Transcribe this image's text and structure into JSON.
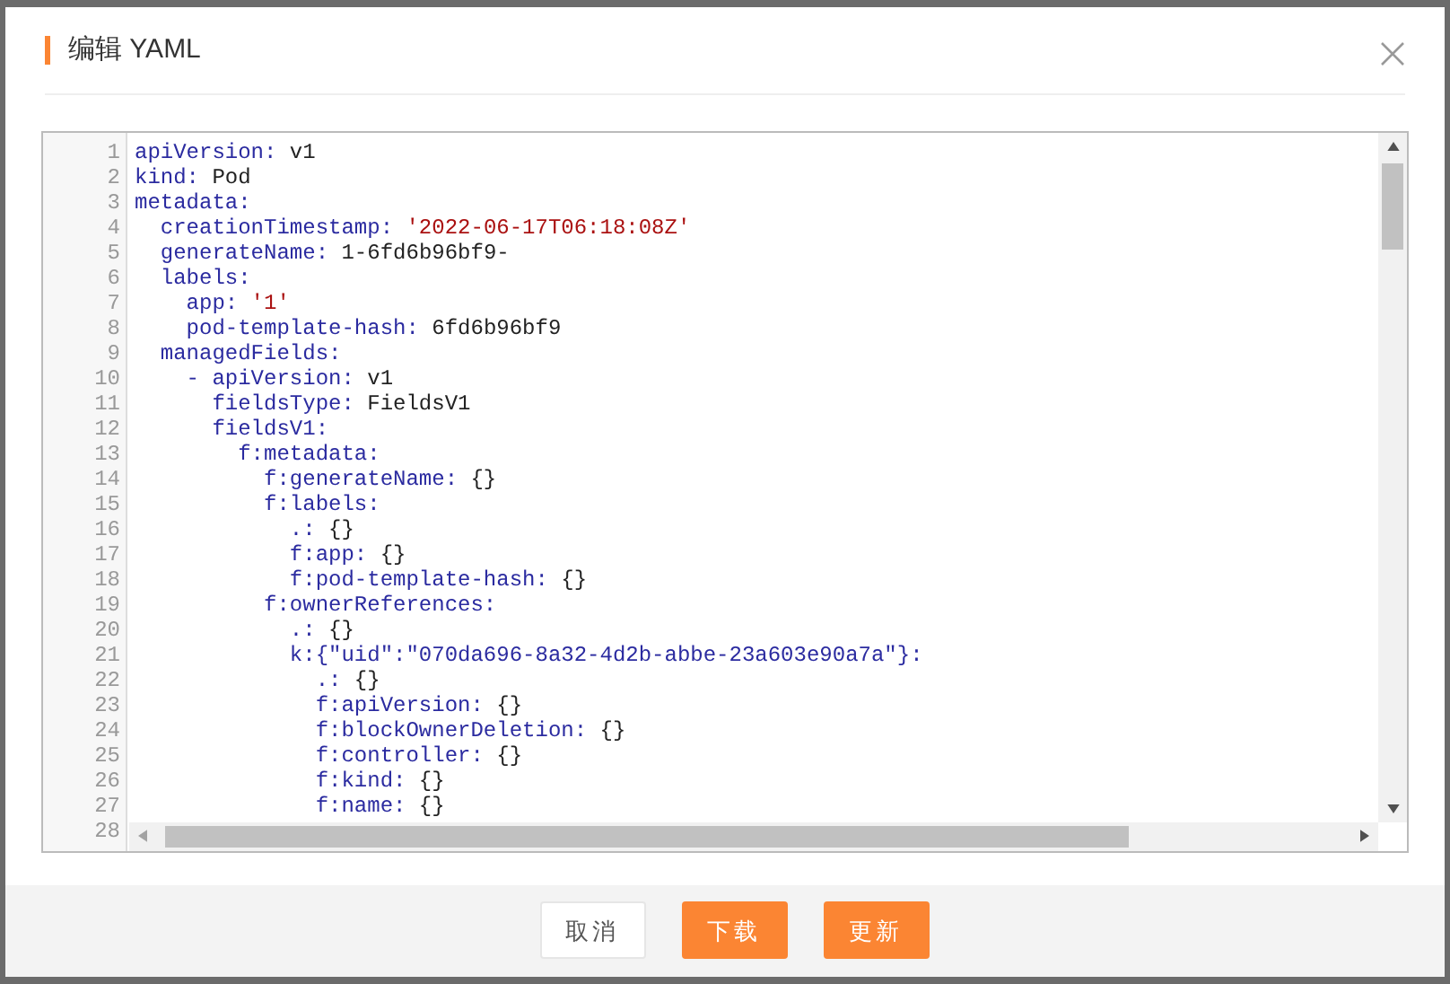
{
  "dialog": {
    "title": "编辑 YAML"
  },
  "editor": {
    "lines": [
      {
        "number": "1",
        "key": "apiVersion:",
        "value": " v1",
        "kind": "plain"
      },
      {
        "number": "2",
        "key": "kind:",
        "value": " Pod",
        "kind": "plain"
      },
      {
        "number": "3",
        "key": "metadata:"
      },
      {
        "number": "4",
        "key": "  creationTimestamp:",
        "value": " '2022-06-17T06:18:08Z'",
        "kind": "string"
      },
      {
        "number": "5",
        "key": "  generateName:",
        "value": " 1-6fd6b96bf9-",
        "kind": "plain"
      },
      {
        "number": "6",
        "key": "  labels:"
      },
      {
        "number": "7",
        "key": "    app:",
        "value": " '1'",
        "kind": "string"
      },
      {
        "number": "8",
        "key": "    pod-template-hash:",
        "value": " 6fd6b96bf9",
        "kind": "plain"
      },
      {
        "number": "9",
        "key": "  managedFields:"
      },
      {
        "number": "10",
        "key": "    - apiVersion:",
        "value": " v1",
        "kind": "plain"
      },
      {
        "number": "11",
        "key": "      fieldsType:",
        "value": " FieldsV1",
        "kind": "plain"
      },
      {
        "number": "12",
        "key": "      fieldsV1:"
      },
      {
        "number": "13",
        "key": "        f:metadata:"
      },
      {
        "number": "14",
        "key": "          f:generateName:",
        "value": " {}",
        "kind": "plain"
      },
      {
        "number": "15",
        "key": "          f:labels:"
      },
      {
        "number": "16",
        "key": "            .:",
        "value": " {}",
        "kind": "plain"
      },
      {
        "number": "17",
        "key": "            f:app:",
        "value": " {}",
        "kind": "plain"
      },
      {
        "number": "18",
        "key": "            f:pod-template-hash:",
        "value": " {}",
        "kind": "plain"
      },
      {
        "number": "19",
        "key": "          f:ownerReferences:"
      },
      {
        "number": "20",
        "key": "            .:",
        "value": " {}",
        "kind": "plain"
      },
      {
        "number": "21",
        "key": "            k:{\"uid\":\"070da696-8a32-4d2b-abbe-23a603e90a7a\"}:"
      },
      {
        "number": "22",
        "key": "              .:",
        "value": " {}",
        "kind": "plain"
      },
      {
        "number": "23",
        "key": "              f:apiVersion:",
        "value": " {}",
        "kind": "plain"
      },
      {
        "number": "24",
        "key": "              f:blockOwnerDeletion:",
        "value": " {}",
        "kind": "plain"
      },
      {
        "number": "25",
        "key": "              f:controller:",
        "value": " {}",
        "kind": "plain"
      },
      {
        "number": "26",
        "key": "              f:kind:",
        "value": " {}",
        "kind": "plain"
      },
      {
        "number": "27",
        "key": "              f:name:",
        "value": " {}",
        "kind": "plain"
      },
      {
        "number": "28"
      }
    ]
  },
  "buttons": [
    {
      "label": "取消",
      "kind": "secondary"
    },
    {
      "label": "下载",
      "kind": "primary"
    },
    {
      "label": "更新",
      "kind": "primary"
    }
  ]
}
